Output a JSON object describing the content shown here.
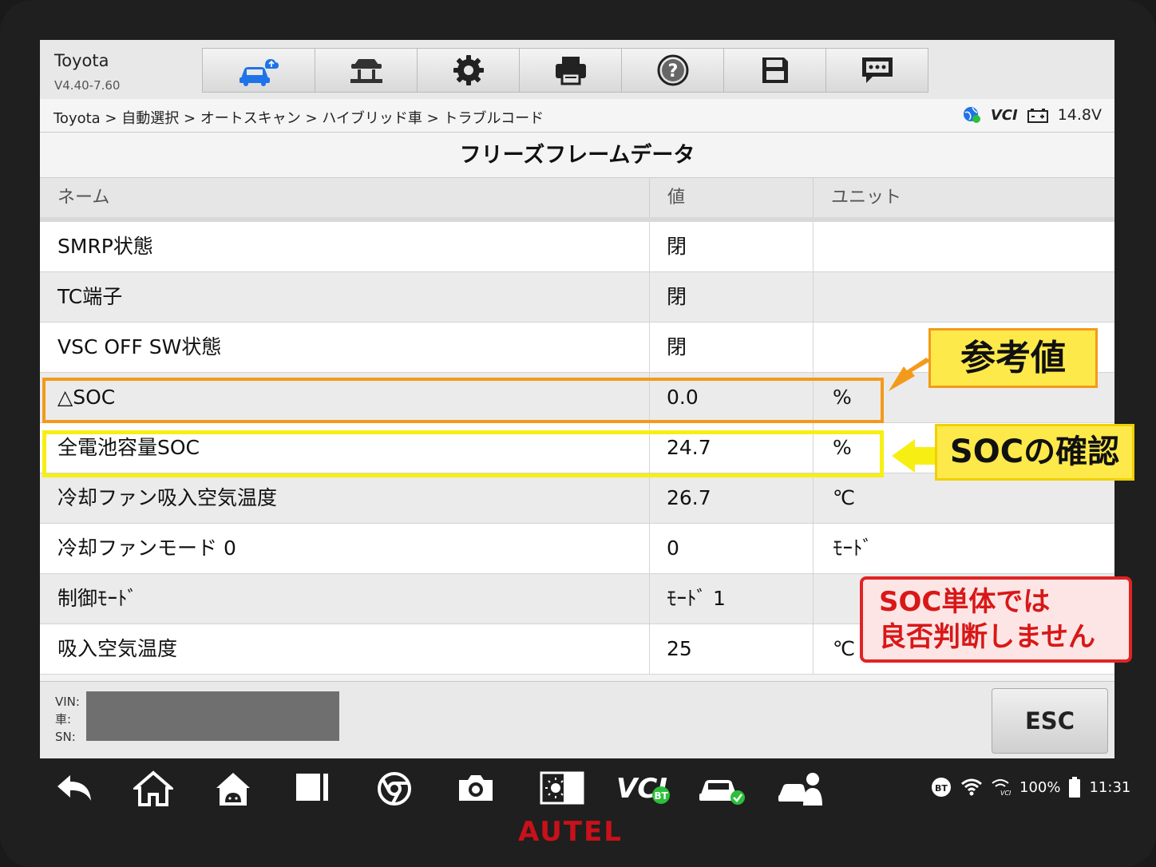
{
  "app": {
    "name": "Toyota",
    "version": "V4.40-7.60"
  },
  "toolbar": {
    "buttons": [
      {
        "icon": "car-cloud-icon"
      },
      {
        "icon": "lift-icon"
      },
      {
        "icon": "gear-icon"
      },
      {
        "icon": "printer-icon"
      },
      {
        "icon": "help-icon"
      },
      {
        "icon": "save-icon"
      },
      {
        "icon": "message-icon"
      }
    ]
  },
  "breadcrumb": "Toyota > 自動選択 > オートスキャン > ハイブリッド車 > トラブルコード",
  "status": {
    "vci": "VCI",
    "voltage": "14.8V"
  },
  "page_title": "フリーズフレームデータ",
  "table": {
    "headers": {
      "name": "ネーム",
      "value": "値",
      "unit": "ユニット"
    },
    "rows": [
      {
        "name": "SMRP状態",
        "value": "閉",
        "unit": ""
      },
      {
        "name": "TC端子",
        "value": "閉",
        "unit": ""
      },
      {
        "name": "VSC OFF SW状態",
        "value": "閉",
        "unit": ""
      },
      {
        "name": "△SOC",
        "value": "0.0",
        "unit": "%"
      },
      {
        "name": "全電池容量SOC",
        "value": "24.7",
        "unit": "%"
      },
      {
        "name": "冷却ファン吸入空気温度",
        "value": "26.7",
        "unit": "℃"
      },
      {
        "name": "冷却ファンモード 0",
        "value": "0",
        "unit": "ﾓｰﾄﾞ"
      },
      {
        "name": "制御ﾓｰﾄﾞ",
        "value": "ﾓｰﾄﾞ 1",
        "unit": ""
      },
      {
        "name": "吸入空気温度",
        "value": "25",
        "unit": "℃"
      }
    ]
  },
  "footer": {
    "vin_label": "VIN:",
    "car_label": "車:",
    "sn_label": "SN:",
    "esc_label": "ESC"
  },
  "annotations": {
    "reference": "参考値",
    "soc_check": "SOCの確認",
    "note_line1": "SOC単体では",
    "note_line2": "良否判断しません"
  },
  "system": {
    "bt": "BT",
    "battery": "100%",
    "time": "11:31"
  },
  "brand": "AUTEL",
  "colors": {
    "orange": "#f39a1b",
    "yellow": "#f7ef14",
    "red": "#e12323",
    "accent_blue": "#1e73e8"
  }
}
